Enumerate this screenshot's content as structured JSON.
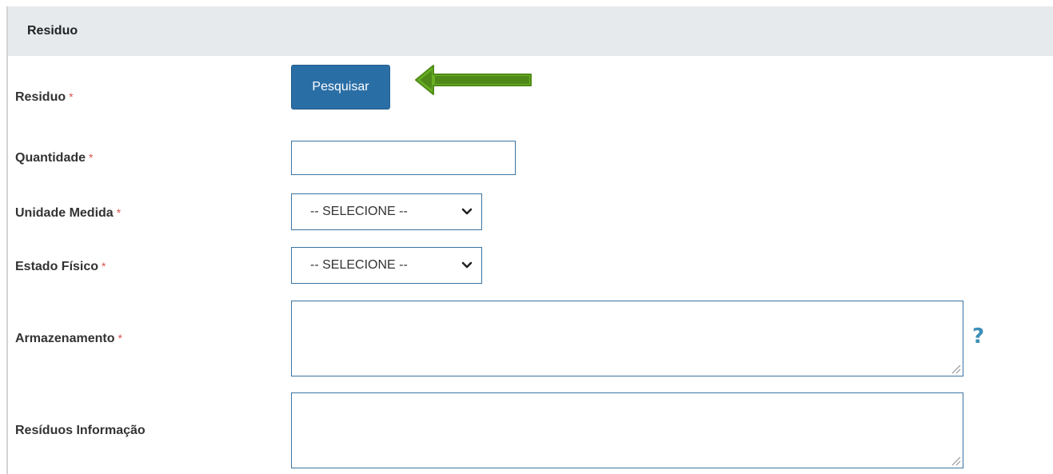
{
  "section": {
    "title": "Residuo"
  },
  "fields": {
    "residuo": {
      "label": "Residuo",
      "required_mark": "*",
      "button_label": "Pesquisar"
    },
    "quantidade": {
      "label": "Quantidade",
      "required_mark": "*",
      "value": ""
    },
    "unidade_medida": {
      "label": "Unidade Medida",
      "required_mark": "*",
      "selected": "-- SELECIONE --"
    },
    "estado_fisico": {
      "label": "Estado Físico",
      "required_mark": "*",
      "selected": "-- SELECIONE --"
    },
    "armazenamento": {
      "label": "Armazenamento",
      "required_mark": "*",
      "value": "",
      "help_glyph": "?"
    },
    "residuos_informacao": {
      "label": "Resíduos Informação",
      "value": ""
    }
  },
  "icons": {
    "annotation_arrow": "left-arrow-icon",
    "select_chevron": "chevron-down-icon",
    "help": "question-mark-icon",
    "resize": "resize-grip-icon"
  },
  "colors": {
    "header_bg": "#e6eaed",
    "button_bg": "#2a6ea6",
    "input_border": "#3a74a3",
    "required": "#d9534f",
    "arrow_green": "#6ab023",
    "help": "#3d8fb7"
  }
}
